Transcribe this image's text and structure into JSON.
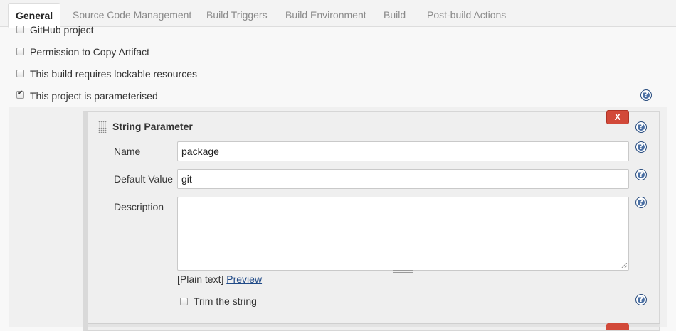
{
  "tabs": [
    {
      "label": "General",
      "active": true
    },
    {
      "label": "Source Code Management",
      "active": false
    },
    {
      "label": "Build Triggers",
      "active": false
    },
    {
      "label": "Build Environment",
      "active": false
    },
    {
      "label": "Build",
      "active": false
    },
    {
      "label": "Post-build Actions",
      "active": false
    }
  ],
  "options": [
    {
      "label": "GitHub project",
      "checked": false
    },
    {
      "label": "Permission to Copy Artifact",
      "checked": false
    },
    {
      "label": "This build requires lockable resources",
      "checked": false
    },
    {
      "label": "This project is parameterised",
      "checked": true
    }
  ],
  "parameter": {
    "title": "String Parameter",
    "delete_label": "X",
    "name_label": "Name",
    "name_value": "package",
    "default_label": "Default Value",
    "default_value": "git",
    "description_label": "Description",
    "description_value": "",
    "format_note": "[Plain text]",
    "preview_link": "Preview",
    "trim_label": "Trim the string",
    "trim_checked": false
  },
  "help_glyph": "?",
  "colors": {
    "accent_help": "#4a6fa3",
    "delete_red": "#d24939",
    "link": "#204a87"
  }
}
